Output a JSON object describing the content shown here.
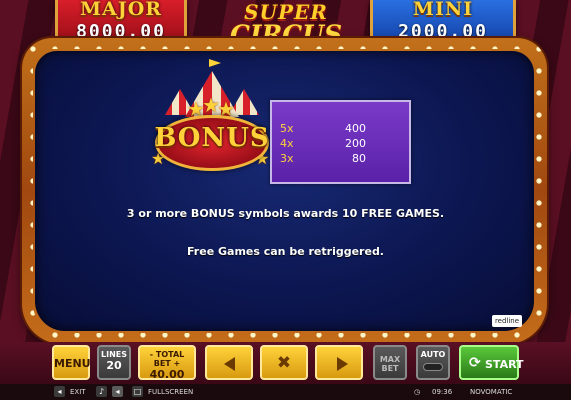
{
  "jackpots": {
    "major": {
      "title": "MAJOR",
      "value": "8000.00"
    },
    "mini": {
      "title": "MINI",
      "value": "2000.00"
    }
  },
  "logo": {
    "line1": "SUPER",
    "line2": "CIRCUS"
  },
  "bonus_symbol": {
    "label": "BONUS"
  },
  "paytable": [
    {
      "multiplier": "5x",
      "value": "400"
    },
    {
      "multiplier": "4x",
      "value": "200"
    },
    {
      "multiplier": "3x",
      "value": "80"
    }
  ],
  "rules": {
    "line1": "3 or more BONUS symbols awards 10 FREE GAMES.",
    "line2": "Free Games can be retriggered."
  },
  "provider_badge": "redline",
  "controls": {
    "menu": "MENU",
    "lines_label": "LINES",
    "lines_value": "20",
    "total_bet_label": "- TOTAL BET +",
    "total_bet_value": "40.00",
    "max_bet": "MAX BET",
    "auto": "AUTO",
    "start": "START"
  },
  "bottom_bar": {
    "exit": "EXIT",
    "fullscreen": "FULLSCREEN",
    "clock": "09:36",
    "brand": "NOVOMATIC"
  },
  "colors": {
    "panel": "#0c1650",
    "gold": "#ffd23a",
    "major_red": "#d81e2a",
    "mini_blue": "#2a6fe0",
    "paytable_purple": "#6a2ab8",
    "start_green": "#5ac83a"
  },
  "icons": [
    "star-icon",
    "arrow-left-icon",
    "arrow-right-icon",
    "close-icon",
    "start-icon",
    "speaker-icon",
    "clock-icon",
    "settings-icon"
  ]
}
